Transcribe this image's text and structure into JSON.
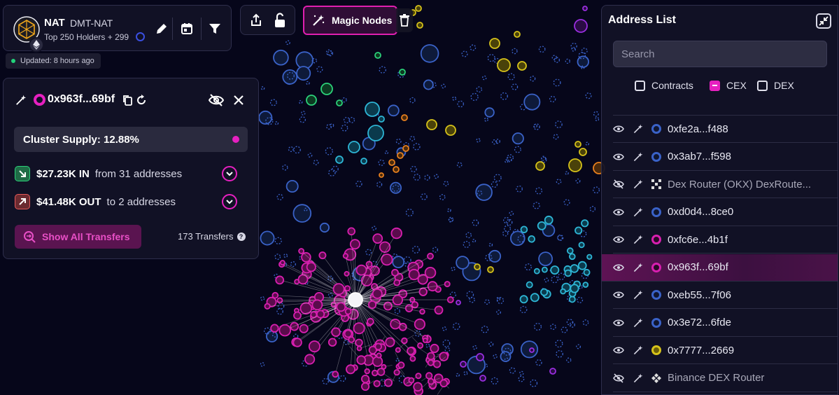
{
  "colors": {
    "accent": "#e620c0",
    "cluster_pink": "#d81fb0",
    "node_blue": "#3a62c8",
    "node_cyan": "#2eb6d6",
    "node_green": "#2cd27a",
    "node_yellow": "#d6c21a",
    "node_orange": "#e8801e",
    "node_purple": "#9a2ee0",
    "panel_bg": "#121226",
    "graph_bg": "#06061a"
  },
  "token": {
    "symbol": "NAT",
    "name": "DMT-NAT",
    "holders": "Top 250 Holders + 299",
    "chain_icon": "ethereum-icon",
    "updated": "Updated: 8 hours ago"
  },
  "toolbar": {
    "magic_nodes": "Magic Nodes",
    "icons": [
      "pencil-icon",
      "calendar-icon",
      "filter-icon",
      "share-icon",
      "lock-open-icon",
      "trash-icon"
    ]
  },
  "cluster": {
    "address": "0x963f...69bf",
    "supply": "Cluster Supply: 12.88%",
    "inflow_amount": "$27.23K IN",
    "inflow_desc": "from 31 addresses",
    "outflow_amount": "$41.48K OUT",
    "outflow_desc": "to 2 addresses",
    "show_transfers": "Show All Transfers",
    "transfers_count": "173 Transfers",
    "help": "?"
  },
  "address_list": {
    "title": "Address List",
    "search_placeholder": "Search",
    "filters": [
      {
        "label": "Contracts",
        "checked": false
      },
      {
        "label": "CEX",
        "checked": true
      },
      {
        "label": "DEX",
        "checked": false
      }
    ],
    "items": [
      {
        "label": "0xfe2a...f488",
        "visible": true,
        "node": "blue"
      },
      {
        "label": "0x3ab7...f598",
        "visible": true,
        "node": "blue"
      },
      {
        "label": "Dex Router (OKX) DexRoute...",
        "visible": false,
        "node": "okx"
      },
      {
        "label": "0xd0d4...8ce0",
        "visible": true,
        "node": "blue"
      },
      {
        "label": "0xfc6e...4b1f",
        "visible": true,
        "node": "pink"
      },
      {
        "label": "0x963f...69bf",
        "visible": true,
        "node": "pink",
        "selected": true
      },
      {
        "label": "0xeb55...7f06",
        "visible": true,
        "node": "blue"
      },
      {
        "label": "0x3e72...6fde",
        "visible": true,
        "node": "blue"
      },
      {
        "label": "0x7777...2669",
        "visible": true,
        "node": "yellow"
      },
      {
        "label": "Binance DEX Router",
        "visible": false,
        "node": "binance"
      }
    ]
  }
}
